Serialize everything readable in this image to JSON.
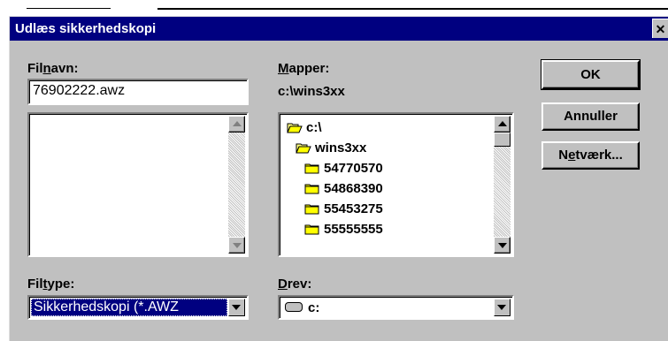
{
  "dialog": {
    "title": "Udlæs sikkerhedskopi",
    "close_label": "✕"
  },
  "filename": {
    "label_pre": "Fil",
    "label_hot": "n",
    "label_post": "avn:",
    "value": "76902222.awz",
    "files": []
  },
  "folders": {
    "label_hot": "M",
    "label_post": "apper:",
    "current_path": "c:\\wins3xx",
    "tree": [
      {
        "name": "c:\\",
        "state": "open",
        "level": 0
      },
      {
        "name": "wins3xx",
        "state": "open",
        "level": 1
      },
      {
        "name": "54770570",
        "state": "closed",
        "level": 2
      },
      {
        "name": "54868390",
        "state": "closed",
        "level": 2
      },
      {
        "name": "55453275",
        "state": "closed",
        "level": 2
      },
      {
        "name": "55555555",
        "state": "closed",
        "level": 2
      }
    ]
  },
  "buttons": {
    "ok": "OK",
    "cancel": "Annuller",
    "network_hot": "e",
    "network_pre": "N",
    "network_post": "tværk..."
  },
  "filetype": {
    "label_pre": "Fil",
    "label_hot": "t",
    "label_post": "ype:",
    "selected": "Sikkerhedskopi (*.AWZ"
  },
  "drive": {
    "label_hot": "D",
    "label_post": "rev:",
    "selected": "c:"
  }
}
